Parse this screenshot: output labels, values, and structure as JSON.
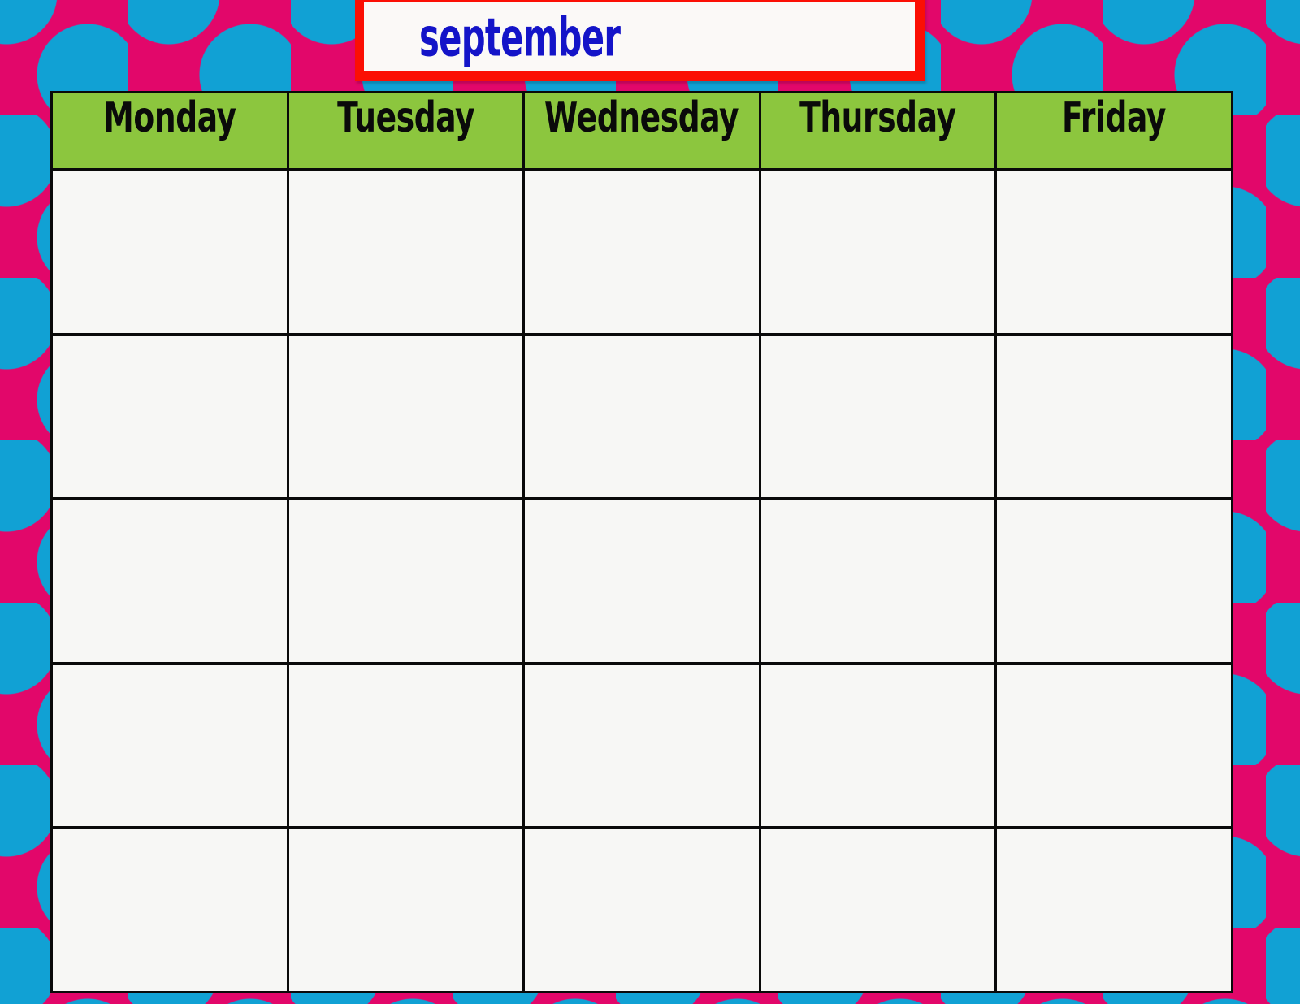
{
  "page": {
    "background_color": "#e2076a",
    "dot_color": "#11a1d4"
  },
  "title_plaque": {
    "month": "september",
    "text_color": "#1414c8",
    "frame_color": "#fb0f04",
    "fill_color": "#fbf9f7"
  },
  "calendar": {
    "header_background": "#8cc63e",
    "cell_background": "#f7f7f5",
    "grid_line_color": "#0a0a0a",
    "weekdays": [
      {
        "label": "Monday"
      },
      {
        "label": "Tuesday"
      },
      {
        "label": "Wednesday"
      },
      {
        "label": "Thursday"
      },
      {
        "label": "Friday"
      }
    ],
    "weeks": [
      {
        "days": [
          {
            "text": ""
          },
          {
            "text": ""
          },
          {
            "text": ""
          },
          {
            "text": ""
          },
          {
            "text": ""
          }
        ]
      },
      {
        "days": [
          {
            "text": ""
          },
          {
            "text": ""
          },
          {
            "text": ""
          },
          {
            "text": ""
          },
          {
            "text": ""
          }
        ]
      },
      {
        "days": [
          {
            "text": ""
          },
          {
            "text": ""
          },
          {
            "text": ""
          },
          {
            "text": ""
          },
          {
            "text": ""
          }
        ]
      },
      {
        "days": [
          {
            "text": ""
          },
          {
            "text": ""
          },
          {
            "text": ""
          },
          {
            "text": ""
          },
          {
            "text": ""
          }
        ]
      },
      {
        "days": [
          {
            "text": ""
          },
          {
            "text": ""
          },
          {
            "text": ""
          },
          {
            "text": ""
          },
          {
            "text": ""
          }
        ]
      }
    ]
  }
}
